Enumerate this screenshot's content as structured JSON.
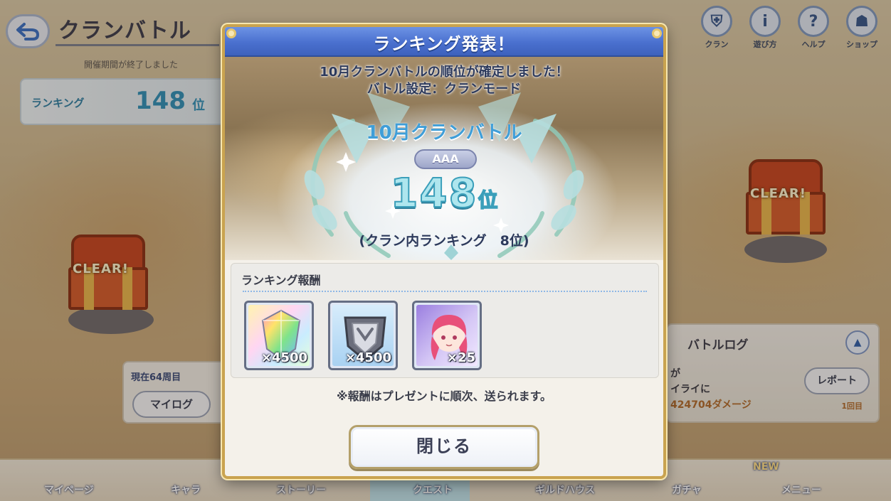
{
  "background": {
    "screen_title": "クランバトル",
    "period_text": "開催期間が終了しました",
    "ranking_label": "ランキング",
    "ranking_value": "148",
    "ranking_unit": "位",
    "chest_left_label": "CLEAR!",
    "chest_right_label": "CLEAR!",
    "top_icons": [
      {
        "icon": "clan-shield-icon",
        "label": "クラン",
        "glyph": "⛨"
      },
      {
        "icon": "info-icon",
        "label": "遊び方",
        "glyph": "i"
      },
      {
        "icon": "help-icon",
        "label": "ヘルプ",
        "glyph": "?"
      },
      {
        "icon": "shop-icon",
        "label": "ショップ",
        "glyph": "☗"
      }
    ],
    "current_day": "現在64周目",
    "my_log_button": "マイログ",
    "battle_log": {
      "title": "バトルログ",
      "line1": "が",
      "line2": "イライに",
      "line3": "424704ダメージ",
      "report_button": "レポート",
      "count": "1回目"
    },
    "bottom_nav": [
      "マイページ",
      "キャラ",
      "ストーリー",
      "クエスト",
      "ギルドハウス",
      "ガチャ",
      "メニュー"
    ],
    "new_badge": "NEW"
  },
  "modal": {
    "title": "ランキング発表！",
    "confirm_line1": "10月クランバトルの順位が確定しました！",
    "confirm_line2": "バトル設定：クランモード",
    "event_name": "10月クランバトル",
    "grade": "AAA",
    "rank_number": "148",
    "rank_unit": "位",
    "clan_rank": "(クラン内ランキング　8位)",
    "reward_label": "ランキング報酬",
    "rewards": [
      {
        "icon": "rainbow-crystal-icon",
        "quantity": "×4500"
      },
      {
        "icon": "clan-coin-icon",
        "quantity": "×4500"
      },
      {
        "icon": "character-memory-piece-icon",
        "quantity": "×25"
      }
    ],
    "note": "※報酬はプレゼントに順次、送られます。",
    "close_button": "閉じる"
  },
  "colors": {
    "header_blue": "#4a70cf",
    "gold_border": "#c9a34f",
    "rank_cyan": "#aee6ee",
    "event_blue": "#3f9ed8"
  }
}
